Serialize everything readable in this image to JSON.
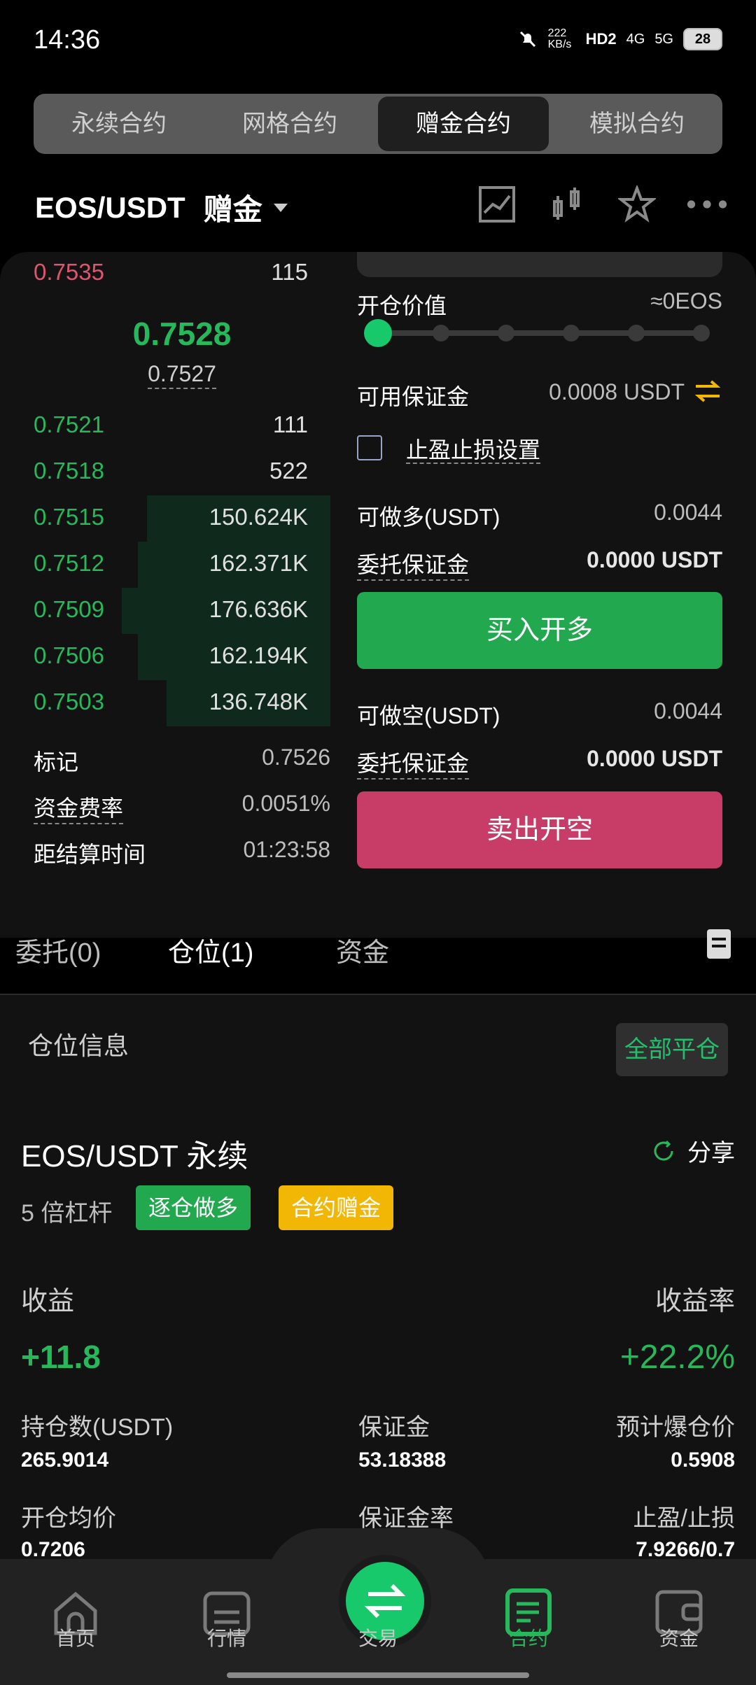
{
  "status_bar": {
    "time": "14:36",
    "net_speed": "222 KB/s",
    "hd": "HD2",
    "n4g": "4G",
    "n5g": "5G",
    "battery": "28"
  },
  "tabs": [
    "永续合约",
    "网格合约",
    "赠金合约",
    "模拟合约"
  ],
  "active_tab": 2,
  "pair": {
    "symbol": "EOS/USDT",
    "type": "赠金"
  },
  "orderbook": {
    "asks": [
      {
        "price": "0.7535",
        "qty": "115"
      }
    ],
    "last_price": "0.7528",
    "index_price": "0.7527",
    "bids": [
      {
        "price": "0.7521",
        "qty": "111",
        "depth": 0
      },
      {
        "price": "0.7518",
        "qty": "522",
        "depth": 0
      },
      {
        "price": "0.7515",
        "qty": "150.624K",
        "depth": 0.82
      },
      {
        "price": "0.7512",
        "qty": "162.371K",
        "depth": 0.86
      },
      {
        "price": "0.7509",
        "qty": "176.636K",
        "depth": 0.93
      },
      {
        "price": "0.7506",
        "qty": "162.194K",
        "depth": 0.86
      },
      {
        "price": "0.7503",
        "qty": "136.748K",
        "depth": 0.73
      }
    ]
  },
  "stats": {
    "mark_label": "标记",
    "mark_value": "0.7526",
    "funding_label": "资金费率",
    "funding_value": "0.0051%",
    "settle_label": "距结算时间",
    "settle_value": "01:23:58"
  },
  "order_form": {
    "open_value_label": "开仓价值",
    "open_value": "≈0EOS",
    "leverage_slider": 0,
    "avail_margin_label": "可用保证金",
    "avail_margin": "0.0008 USDT",
    "tpsl_label": "止盈止损设置",
    "long_label": "可做多(USDT)",
    "long_value": "0.0044",
    "long_margin_label": "委托保证金",
    "long_margin_value": "0.0000 USDT",
    "buy_button": "买入开多",
    "short_label": "可做空(USDT)",
    "short_value": "0.0044",
    "short_margin_label": "委托保证金",
    "short_margin_value": "0.0000 USDT",
    "sell_button": "卖出开空"
  },
  "sub_tabs": [
    "委托(0)",
    "仓位(1)",
    "资金"
  ],
  "active_sub_tab": 1,
  "position": {
    "section_title": "仓位信息",
    "close_all": "全部平仓",
    "name": "EOS/USDT 永续",
    "share": "分享",
    "leverage": "5 倍杠杆",
    "tag_mode": "逐仓做多",
    "tag_bonus": "合约赠金",
    "pnl_label": "收益",
    "pnl_value": "+11.8",
    "roe_label": "收益率",
    "roe_value": "+22.2%",
    "qty_label": "持仓数(USDT)",
    "qty_value": "265.9014",
    "margin_label": "保证金",
    "margin_value": "53.18388",
    "liq_label": "预计爆仓价",
    "liq_value": "0.5908",
    "entry_label": "开仓均价",
    "entry_value": "0.7206",
    "margin_ratio_label": "保证金率",
    "tpsl_label": "止盈/止损",
    "tpsl_value": "7.9266/0.7"
  },
  "bottom_nav": [
    "首页",
    "行情",
    "交易",
    "合约",
    "资金"
  ],
  "active_nav": 3,
  "colors": {
    "green": "#27b85c",
    "red": "#e0556e",
    "buy": "#22a84f",
    "sell": "#c83d67",
    "bonus_tag": "#f2b705"
  }
}
